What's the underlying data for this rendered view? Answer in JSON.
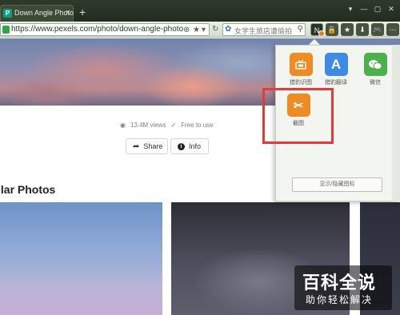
{
  "browser": {
    "tab_title": "Down Angle Photo",
    "tab_favicon": "P",
    "tab_close": "×",
    "new_tab": "+",
    "window_controls": [
      "▾",
      "—",
      "▢",
      "✕"
    ],
    "url": "https://www.pexels.com/photo/down-angle-photog",
    "search_placeholder": "女学生旅店遭偷拍",
    "extensions": [
      "N",
      "🔒",
      "★",
      "⬇",
      "🎮",
      "⋯"
    ]
  },
  "page": {
    "views": "13.4M views",
    "license": "Free to use",
    "share_label": "Share",
    "info_label": "Info",
    "section_title": "ilar Photos"
  },
  "popup": {
    "apps": [
      {
        "name": "猎豹识图",
        "icon": "tv-icon",
        "color": "#f08a22",
        "glyph": "▭"
      },
      {
        "name": "猎豹翻译",
        "icon": "translate-icon",
        "color": "#3d8be6",
        "glyph": "A"
      },
      {
        "name": "微信",
        "icon": "wechat-icon",
        "color": "#4cb04c",
        "glyph": "●"
      },
      {
        "name": "截图",
        "icon": "scissors-icon",
        "color": "#f08a22",
        "glyph": "✂"
      }
    ],
    "toggle_label": "显示/隐藏图标"
  },
  "watermark": {
    "line1": "百科全说",
    "line2": "助你轻松解决"
  },
  "colors": {
    "highlight": "#e33b3b",
    "accent_green": "#05a081"
  }
}
